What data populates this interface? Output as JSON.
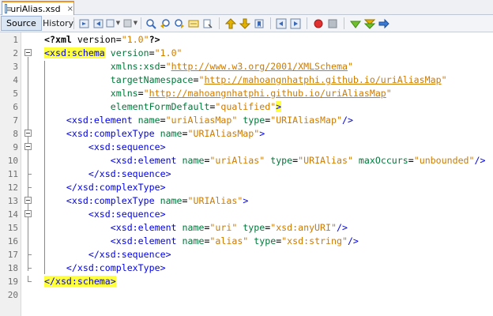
{
  "tab": {
    "filename": "uriAlias.xsd",
    "close": "×"
  },
  "toolbar": {
    "source_label": "Source",
    "history_label": "History"
  },
  "editor": {
    "line_numbers": [
      "1",
      "2",
      "3",
      "4",
      "5",
      "6",
      "7",
      "8",
      "9",
      "10",
      "11",
      "12",
      "13",
      "14",
      "15",
      "16",
      "17",
      "18",
      "19",
      "20"
    ],
    "lines": [
      [
        {
          "t": "pi",
          "s": "<?xml"
        },
        {
          "t": "plain",
          "s": " version="
        },
        {
          "t": "val",
          "s": "\"1.0\""
        },
        {
          "t": "pi",
          "s": "?>"
        }
      ],
      [
        {
          "t": "taghl",
          "s": "<xsd:schema"
        },
        {
          "t": "plain",
          "s": " "
        },
        {
          "t": "attr",
          "s": "version"
        },
        {
          "t": "plain",
          "s": "="
        },
        {
          "t": "val",
          "s": "\"1.0\""
        }
      ],
      [
        {
          "t": "plain",
          "s": "            "
        },
        {
          "t": "attr",
          "s": "xmlns:xsd"
        },
        {
          "t": "plain",
          "s": "="
        },
        {
          "t": "val",
          "s": "\""
        },
        {
          "t": "url",
          "s": "http://www.w3.org/2001/XMLSchema"
        },
        {
          "t": "val",
          "s": "\""
        }
      ],
      [
        {
          "t": "plain",
          "s": "            "
        },
        {
          "t": "attr",
          "s": "targetNamespace"
        },
        {
          "t": "plain",
          "s": "="
        },
        {
          "t": "val",
          "s": "\""
        },
        {
          "t": "url",
          "s": "http://mahoangnhatphi.github.io/uriAliasMap"
        },
        {
          "t": "val",
          "s": "\""
        }
      ],
      [
        {
          "t": "plain",
          "s": "            "
        },
        {
          "t": "attr",
          "s": "xmlns"
        },
        {
          "t": "plain",
          "s": "="
        },
        {
          "t": "val",
          "s": "\""
        },
        {
          "t": "url",
          "s": "http://mahoangnhatphi.github.io/uriAliasMap"
        },
        {
          "t": "val",
          "s": "\""
        }
      ],
      [
        {
          "t": "plain",
          "s": "            "
        },
        {
          "t": "attr",
          "s": "elementFormDefault"
        },
        {
          "t": "plain",
          "s": "="
        },
        {
          "t": "val",
          "s": "\"qualified\""
        },
        {
          "t": "taghl",
          "s": ">"
        }
      ],
      [
        {
          "t": "plain",
          "s": "    "
        },
        {
          "t": "tag",
          "s": "<xsd:element"
        },
        {
          "t": "plain",
          "s": " "
        },
        {
          "t": "attr",
          "s": "name"
        },
        {
          "t": "plain",
          "s": "="
        },
        {
          "t": "val",
          "s": "\"uriAliasMap\""
        },
        {
          "t": "plain",
          "s": " "
        },
        {
          "t": "attr",
          "s": "type"
        },
        {
          "t": "plain",
          "s": "="
        },
        {
          "t": "val",
          "s": "\"URIAliasMap\""
        },
        {
          "t": "tag",
          "s": "/>"
        }
      ],
      [
        {
          "t": "plain",
          "s": "    "
        },
        {
          "t": "tag",
          "s": "<xsd:complexType"
        },
        {
          "t": "plain",
          "s": " "
        },
        {
          "t": "attr",
          "s": "name"
        },
        {
          "t": "plain",
          "s": "="
        },
        {
          "t": "val",
          "s": "\"URIAliasMap\""
        },
        {
          "t": "tag",
          "s": ">"
        }
      ],
      [
        {
          "t": "plain",
          "s": "        "
        },
        {
          "t": "tag",
          "s": "<xsd:sequence>"
        }
      ],
      [
        {
          "t": "plain",
          "s": "            "
        },
        {
          "t": "tag",
          "s": "<xsd:element"
        },
        {
          "t": "plain",
          "s": " "
        },
        {
          "t": "attr",
          "s": "name"
        },
        {
          "t": "plain",
          "s": "="
        },
        {
          "t": "val",
          "s": "\"uriAlias\""
        },
        {
          "t": "plain",
          "s": " "
        },
        {
          "t": "attr",
          "s": "type"
        },
        {
          "t": "plain",
          "s": "="
        },
        {
          "t": "val",
          "s": "\"URIAlias\""
        },
        {
          "t": "plain",
          "s": " "
        },
        {
          "t": "attr",
          "s": "maxOccurs"
        },
        {
          "t": "plain",
          "s": "="
        },
        {
          "t": "val",
          "s": "\"unbounded\""
        },
        {
          "t": "tag",
          "s": "/>"
        }
      ],
      [
        {
          "t": "plain",
          "s": "        "
        },
        {
          "t": "tag",
          "s": "</xsd:sequence>"
        }
      ],
      [
        {
          "t": "plain",
          "s": "    "
        },
        {
          "t": "tag",
          "s": "</xsd:complexType>"
        }
      ],
      [
        {
          "t": "plain",
          "s": "    "
        },
        {
          "t": "tag",
          "s": "<xsd:complexType"
        },
        {
          "t": "plain",
          "s": " "
        },
        {
          "t": "attr",
          "s": "name"
        },
        {
          "t": "plain",
          "s": "="
        },
        {
          "t": "val",
          "s": "\"URIAlias\""
        },
        {
          "t": "tag",
          "s": ">"
        }
      ],
      [
        {
          "t": "plain",
          "s": "        "
        },
        {
          "t": "tag",
          "s": "<xsd:sequence>"
        }
      ],
      [
        {
          "t": "plain",
          "s": "            "
        },
        {
          "t": "tag",
          "s": "<xsd:element"
        },
        {
          "t": "plain",
          "s": " "
        },
        {
          "t": "attr",
          "s": "name"
        },
        {
          "t": "plain",
          "s": "="
        },
        {
          "t": "val",
          "s": "\"uri\""
        },
        {
          "t": "plain",
          "s": " "
        },
        {
          "t": "attr",
          "s": "type"
        },
        {
          "t": "plain",
          "s": "="
        },
        {
          "t": "val",
          "s": "\"xsd:anyURI\""
        },
        {
          "t": "tag",
          "s": "/>"
        }
      ],
      [
        {
          "t": "plain",
          "s": "            "
        },
        {
          "t": "tag",
          "s": "<xsd:element"
        },
        {
          "t": "plain",
          "s": " "
        },
        {
          "t": "attr",
          "s": "name"
        },
        {
          "t": "plain",
          "s": "="
        },
        {
          "t": "val",
          "s": "\"alias\""
        },
        {
          "t": "plain",
          "s": " "
        },
        {
          "t": "attr",
          "s": "type"
        },
        {
          "t": "plain",
          "s": "="
        },
        {
          "t": "val",
          "s": "\"xsd:string\""
        },
        {
          "t": "tag",
          "s": "/>"
        }
      ],
      [
        {
          "t": "plain",
          "s": "        "
        },
        {
          "t": "tag",
          "s": "</xsd:sequence>"
        }
      ],
      [
        {
          "t": "plain",
          "s": "    "
        },
        {
          "t": "tag",
          "s": "</xsd:complexType>"
        }
      ],
      [
        {
          "t": "taghl",
          "s": "</xsd:schema>"
        }
      ],
      []
    ]
  },
  "colors": {
    "tag": "#0000e6",
    "attribute": "#00793a",
    "value": "#ce7b00",
    "highlight": "#ffff3c",
    "tab_accent": "#f29223"
  }
}
